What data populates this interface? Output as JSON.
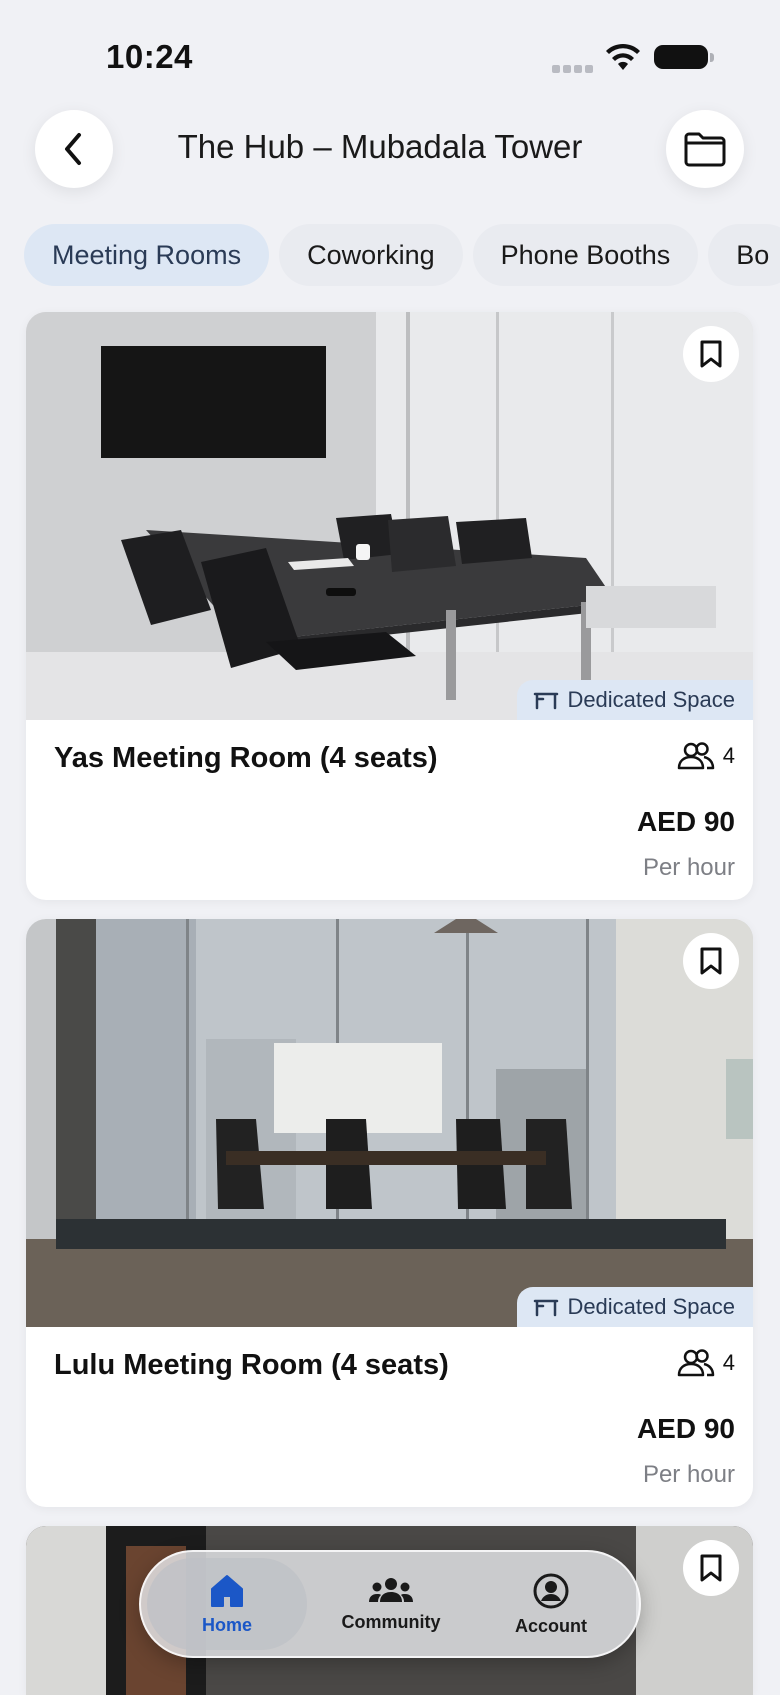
{
  "status_bar": {
    "time": "10:24"
  },
  "header": {
    "title": "The Hub – Mubadala Tower"
  },
  "tabs": [
    {
      "label": "Meeting Rooms",
      "active": true
    },
    {
      "label": "Coworking",
      "active": false
    },
    {
      "label": "Phone Booths",
      "active": false
    },
    {
      "label": "Bo",
      "active": false
    }
  ],
  "cards": [
    {
      "title": "Yas Meeting Room (4 seats)",
      "badge": "Dedicated Space",
      "seats": "4",
      "price": "AED 90",
      "unit": "Per hour"
    },
    {
      "title": "Lulu Meeting Room (4 seats)",
      "badge": "Dedicated Space",
      "seats": "4",
      "price": "AED 90",
      "unit": "Per hour"
    }
  ],
  "bottom_nav": {
    "home": "Home",
    "community": "Community",
    "account": "Account"
  },
  "colors": {
    "accent": "#1b57c7",
    "active_tab_bg": "#dde7f4",
    "background": "#f0f1f5"
  },
  "icons": [
    "chevron-left-icon",
    "folder-icon",
    "bookmark-icon",
    "desk-icon",
    "users-icon",
    "home-icon",
    "community-icon",
    "account-icon"
  ]
}
